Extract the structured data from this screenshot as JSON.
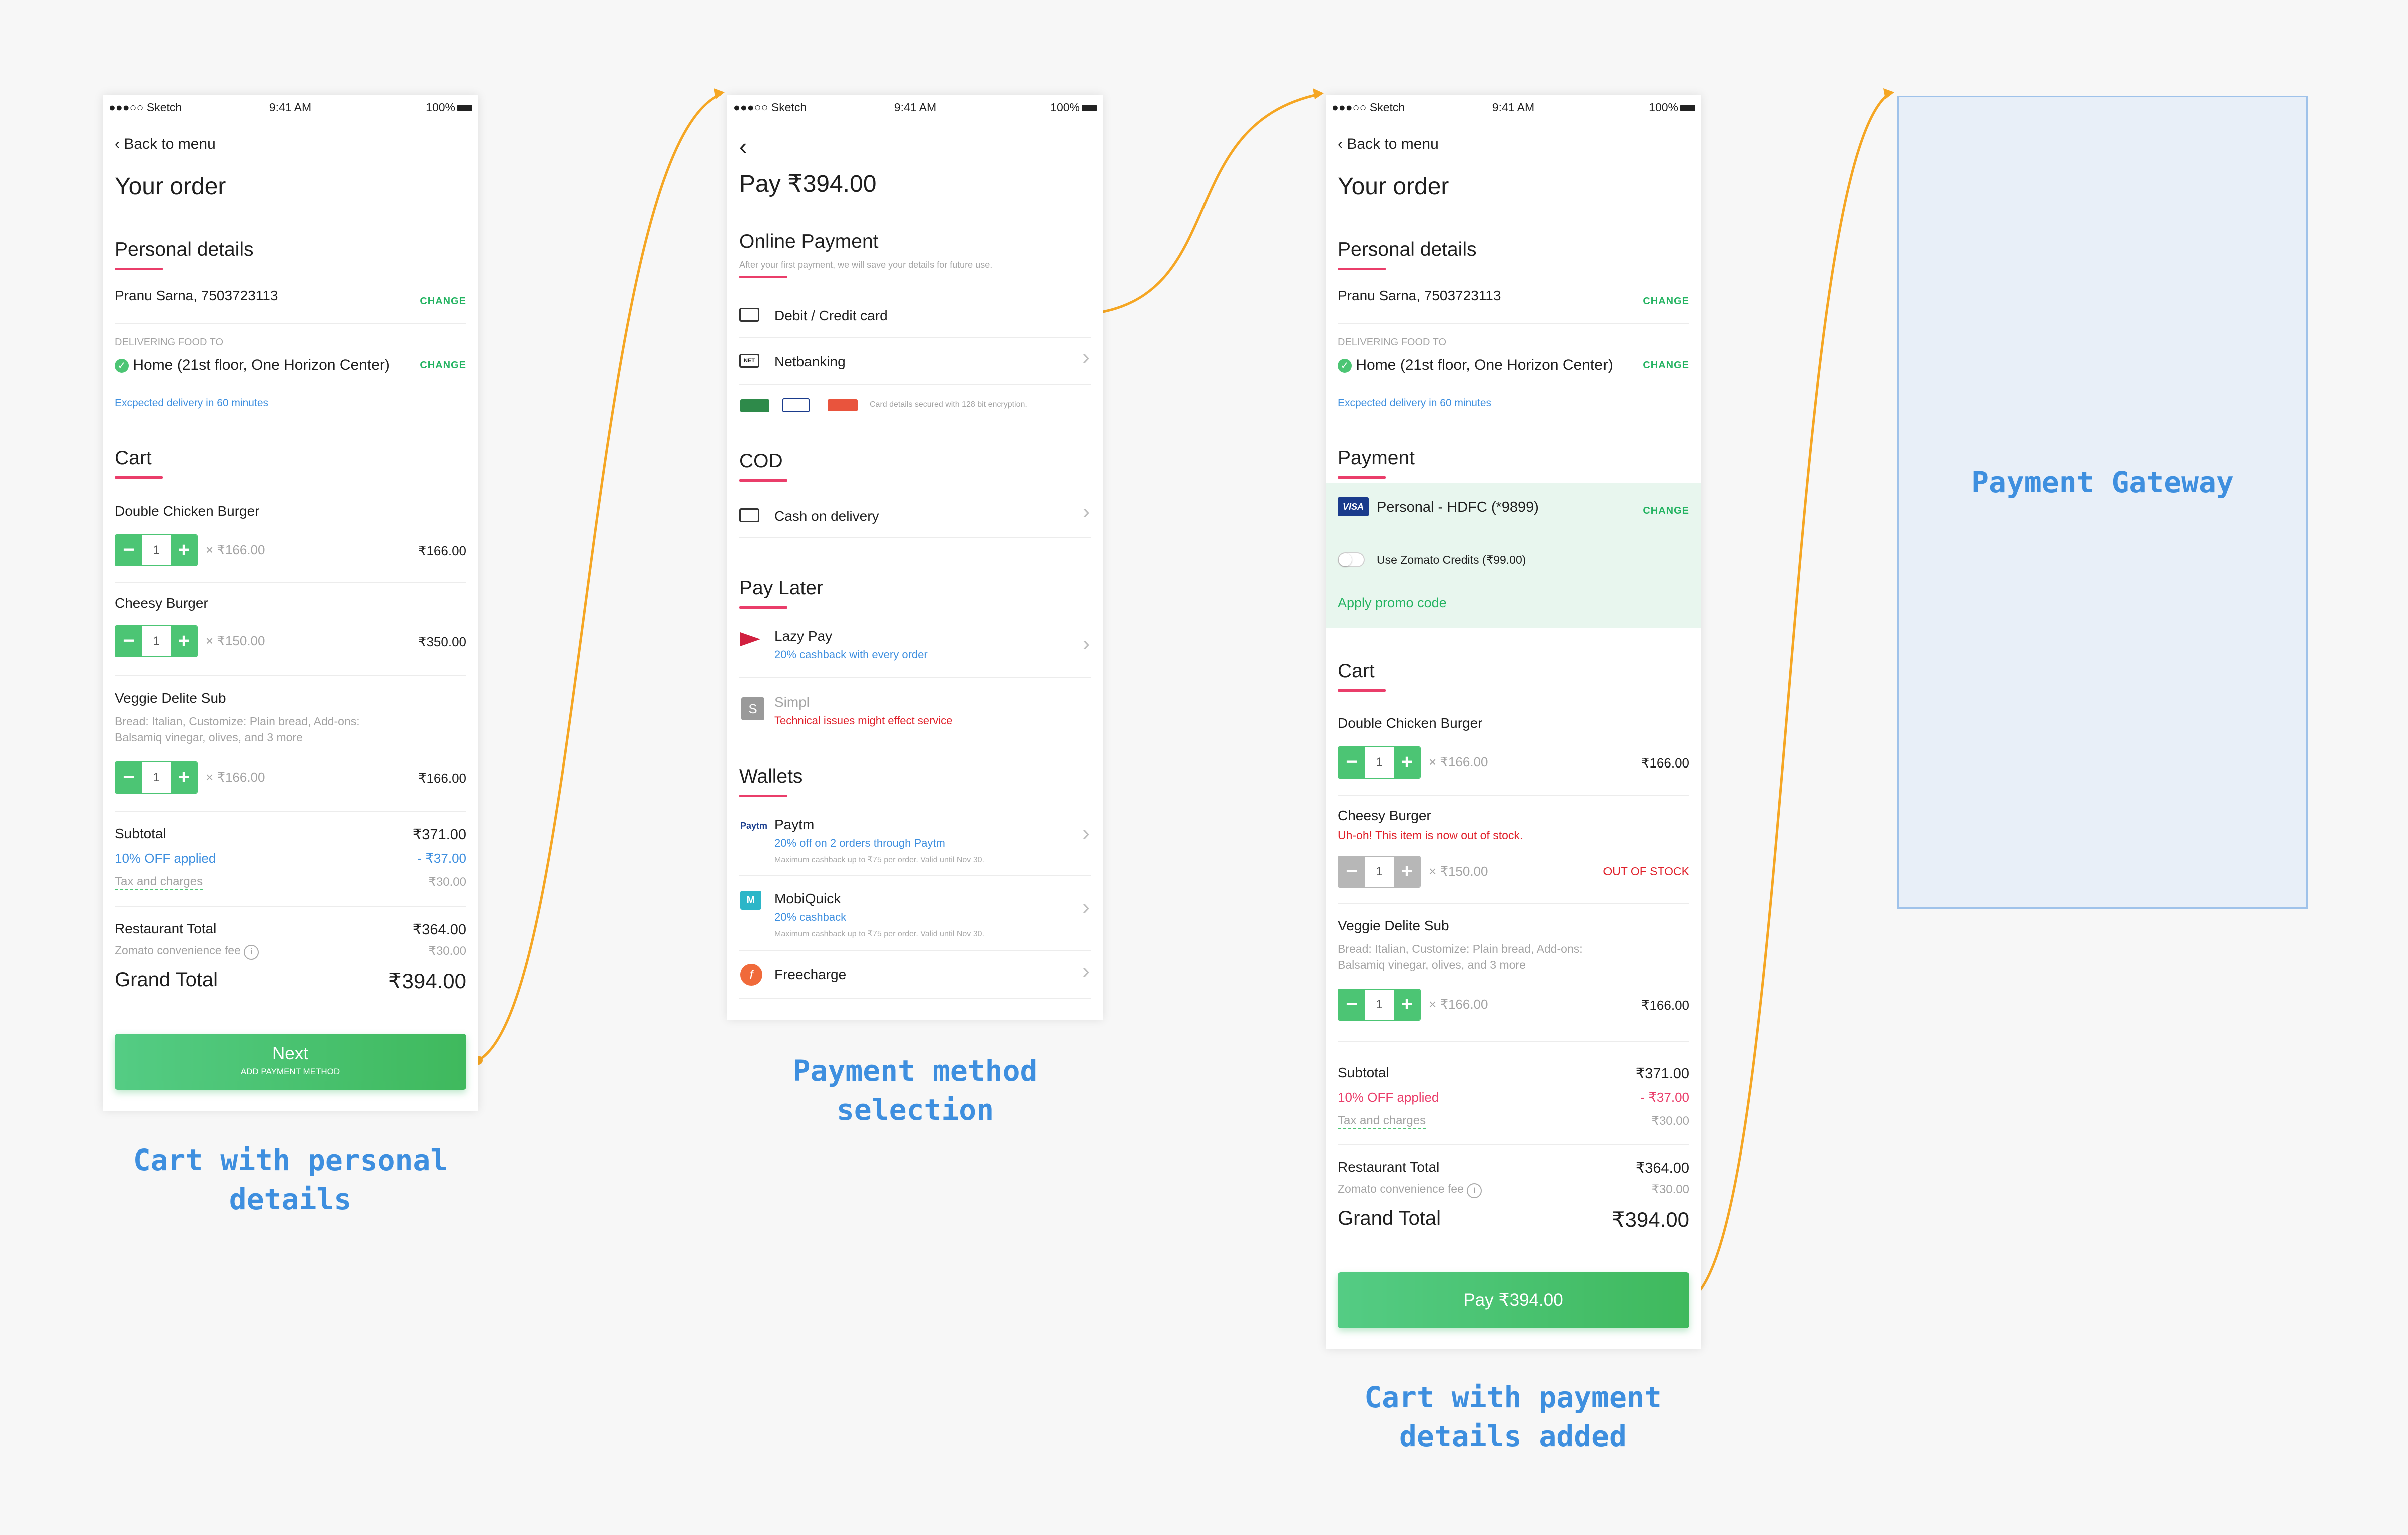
{
  "status_bar": {
    "carrier": "●●●○○ Sketch",
    "time": "9:41 AM",
    "battery": "100%"
  },
  "screen1": {
    "back": "Back to menu",
    "title": "Your order",
    "personal_title": "Personal details",
    "person": "Pranu Sarna, 7503723113",
    "change": "CHANGE",
    "delivering_label": "DELIVERING FOOD TO",
    "address": "Home (21st floor, One Horizon Center)",
    "eta": "Excpected delivery in 60 minutes",
    "cart_title": "Cart",
    "items": [
      {
        "name": "Double Chicken Burger",
        "qty": "1",
        "unit": "× ₹166.00",
        "total": "₹166.00",
        "desc": ""
      },
      {
        "name": "Cheesy Burger",
        "qty": "1",
        "unit": "× ₹150.00",
        "total": "₹350.00",
        "desc": ""
      },
      {
        "name": "Veggie Delite Sub",
        "qty": "1",
        "unit": "× ₹166.00",
        "total": "₹166.00",
        "desc": "Bread: Italian, Customize: Plain bread, Add-ons: Balsamiq vinegar, olives, and 3 more"
      }
    ],
    "subtotal_label": "Subtotal",
    "subtotal": "₹371.00",
    "discount_label": "10% OFF applied",
    "discount": "- ₹37.00",
    "tax_label": "Tax and charges",
    "tax": "₹30.00",
    "restaurant_label": "Restaurant Total",
    "restaurant": "₹364.00",
    "fee_label": "Zomato convenience fee",
    "fee": "₹30.00",
    "grand_label": "Grand Total",
    "grand": "₹394.00",
    "cta": "Next",
    "cta_sub": "ADD PAYMENT METHOD"
  },
  "screen2": {
    "title": "Pay ₹394.00",
    "online_title": "Online Payment",
    "online_note": "After your first payment, we will save your details for future use.",
    "debit": "Debit / Credit card",
    "netbanking": "Netbanking",
    "secured": "Card details secured with 128 bit encryption.",
    "cod_title": "COD",
    "cod": "Cash on delivery",
    "later_title": "Pay Later",
    "lazypay": "Lazy Pay",
    "lazypay_sub": "20% cashback with every order",
    "simpl": "Simpl",
    "simpl_sub": "Technical issues might effect service",
    "wallets_title": "Wallets",
    "paytm": "Paytm",
    "paytm_sub": "20% off on 2 orders through Paytm",
    "paytm_fine": "Maximum cashback up to ₹75 per order. Valid until Nov 30.",
    "mobikwik": "MobiQuick",
    "mobikwik_sub": "20% cashback",
    "mobikwik_fine": "Maximum cashback up to ₹75 per order. Valid until Nov 30.",
    "freecharge": "Freecharge"
  },
  "screen3": {
    "payment_title": "Payment",
    "card": "Personal - HDFC (*9899)",
    "credits": "Use Zomato Credits (₹99.00)",
    "promo": "Apply promo code",
    "oos_msg": "Uh-oh! This item is now out of stock.",
    "oos": "OUT OF STOCK",
    "cta": "Pay ₹394.00"
  },
  "gateway": {
    "label": "Payment Gateway"
  },
  "captions": {
    "c1": "Cart with personal\ndetails",
    "c2": "Payment method\nselection",
    "c3": "Cart with payment\ndetails added"
  },
  "colors": {
    "accent_green": "#4cc574",
    "underline_pink": "#ea3d6a",
    "link_blue": "#3e8fdf",
    "flow_orange": "#f5a623",
    "gateway_fill": "#e8eff8"
  }
}
